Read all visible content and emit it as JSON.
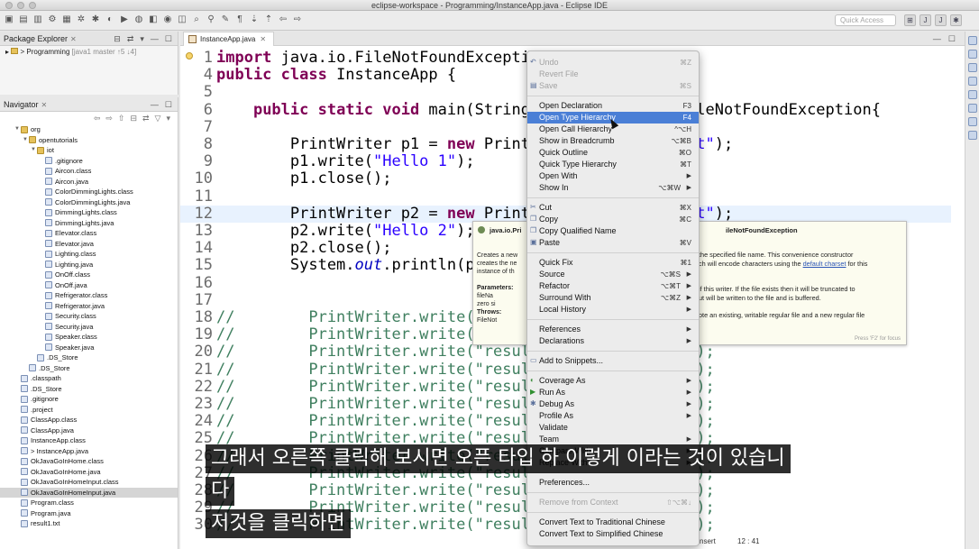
{
  "window": {
    "title": "eclipse-workspace - Programming/InstanceApp.java - Eclipse IDE",
    "quick_access_placeholder": "Quick Access"
  },
  "package_explorer": {
    "title": "Package Explorer",
    "project_label": "> Programming",
    "project_meta": "[java1 master ↑5 ↓4]"
  },
  "navigator": {
    "title": "Navigator",
    "items": [
      {
        "indent": 1,
        "twisty": "▼",
        "icon": "folder",
        "label": "org"
      },
      {
        "indent": 2,
        "twisty": "▼",
        "icon": "folder",
        "label": "opentutorials"
      },
      {
        "indent": 3,
        "twisty": "▼",
        "icon": "folder",
        "label": "iot"
      },
      {
        "indent": 4,
        "twisty": "",
        "icon": "file",
        "label": ".gitignore"
      },
      {
        "indent": 4,
        "twisty": "",
        "icon": "file",
        "label": "Aircon.class"
      },
      {
        "indent": 4,
        "twisty": "",
        "icon": "file",
        "label": "Aircon.java"
      },
      {
        "indent": 4,
        "twisty": "",
        "icon": "file",
        "label": "ColorDimmingLights.class"
      },
      {
        "indent": 4,
        "twisty": "",
        "icon": "file",
        "label": "ColorDimmingLights.java"
      },
      {
        "indent": 4,
        "twisty": "",
        "icon": "file",
        "label": "DimmingLights.class"
      },
      {
        "indent": 4,
        "twisty": "",
        "icon": "file",
        "label": "DimmingLights.java"
      },
      {
        "indent": 4,
        "twisty": "",
        "icon": "file",
        "label": "Elevator.class"
      },
      {
        "indent": 4,
        "twisty": "",
        "icon": "file",
        "label": "Elevator.java"
      },
      {
        "indent": 4,
        "twisty": "",
        "icon": "file",
        "label": "Lighting.class"
      },
      {
        "indent": 4,
        "twisty": "",
        "icon": "file",
        "label": "Lighting.java"
      },
      {
        "indent": 4,
        "twisty": "",
        "icon": "file",
        "label": "OnOff.class"
      },
      {
        "indent": 4,
        "twisty": "",
        "icon": "file",
        "label": "OnOff.java"
      },
      {
        "indent": 4,
        "twisty": "",
        "icon": "file",
        "label": "Refrigerator.class"
      },
      {
        "indent": 4,
        "twisty": "",
        "icon": "file",
        "label": "Refrigerator.java"
      },
      {
        "indent": 4,
        "twisty": "",
        "icon": "file",
        "label": "Security.class"
      },
      {
        "indent": 4,
        "twisty": "",
        "icon": "file",
        "label": "Security.java"
      },
      {
        "indent": 4,
        "twisty": "",
        "icon": "file",
        "label": "Speaker.class"
      },
      {
        "indent": 4,
        "twisty": "",
        "icon": "file",
        "label": "Speaker.java"
      },
      {
        "indent": 3,
        "twisty": "",
        "icon": "file",
        "label": ".DS_Store"
      },
      {
        "indent": 2,
        "twisty": "",
        "icon": "file",
        "label": ".DS_Store"
      },
      {
        "indent": 1,
        "twisty": "",
        "icon": "file",
        "label": ".classpath"
      },
      {
        "indent": 1,
        "twisty": "",
        "icon": "file",
        "label": ".DS_Store"
      },
      {
        "indent": 1,
        "twisty": "",
        "icon": "file",
        "label": ".gitignore"
      },
      {
        "indent": 1,
        "twisty": "",
        "icon": "file",
        "label": ".project"
      },
      {
        "indent": 1,
        "twisty": "",
        "icon": "file",
        "label": "ClassApp.class"
      },
      {
        "indent": 1,
        "twisty": "",
        "icon": "file",
        "label": "ClassApp.java"
      },
      {
        "indent": 1,
        "twisty": "",
        "icon": "file",
        "label": "InstanceApp.class"
      },
      {
        "indent": 1,
        "twisty": "",
        "icon": "file",
        "label": "> InstanceApp.java"
      },
      {
        "indent": 1,
        "twisty": "",
        "icon": "file",
        "label": "OkJavaGoInHome.class"
      },
      {
        "indent": 1,
        "twisty": "",
        "icon": "file",
        "label": "OkJavaGoInHome.java"
      },
      {
        "indent": 1,
        "twisty": "",
        "icon": "file",
        "label": "OkJavaGoInHomeInput.class"
      },
      {
        "indent": 1,
        "twisty": "",
        "icon": "file",
        "label": "OkJavaGoInHomeInput.java",
        "selected": true
      },
      {
        "indent": 1,
        "twisty": "",
        "icon": "file",
        "label": "Program.class"
      },
      {
        "indent": 1,
        "twisty": "",
        "icon": "file",
        "label": "Program.java"
      },
      {
        "indent": 1,
        "twisty": "",
        "icon": "file",
        "label": "result1.txt"
      }
    ]
  },
  "editor": {
    "tab_label": "InstanceApp.java",
    "lines": [
      {
        "n": "1",
        "html": "<span class=\"kw\">import</span> java.io.FileNotFoundException;"
      },
      {
        "n": "4",
        "html": "<span class=\"kw\">public class</span> InstanceApp {"
      },
      {
        "n": "5",
        "html": ""
      },
      {
        "n": "6",
        "html": "    <span class=\"kw\">public static void</span> main(String[] args) <span class=\"kw\">throws</span> FileNotFoundException{"
      },
      {
        "n": "7",
        "html": ""
      },
      {
        "n": "8",
        "html": "        PrintWriter p1 = <span class=\"kw\">new</span> PrintWriter(<span class=\"str\">\"result1.txt\"</span>);"
      },
      {
        "n": "9",
        "html": "        p1.write(<span class=\"str\">\"Hello 1\"</span>);"
      },
      {
        "n": "10",
        "html": "        p1.close();"
      },
      {
        "n": "11",
        "html": ""
      },
      {
        "n": "12",
        "html": "        PrintWriter p2 = <span class=\"kw\">new</span> PrintWriter(<span class=\"str\">\"result2.txt\"</span>);",
        "hl": true
      },
      {
        "n": "13",
        "html": "        p2.write(<span class=\"str\">\"Hello 2\"</span>);"
      },
      {
        "n": "14",
        "html": "        p2.close();"
      },
      {
        "n": "15",
        "html": "        System.<span class=\"fld\">out</span>.println(p1);"
      },
      {
        "n": "16",
        "html": ""
      },
      {
        "n": "17",
        "html": ""
      },
      {
        "n": "18",
        "html": "<span class=\"cmt\">//        PrintWriter.write(\"result1.txt\", \"Hello 1\");</span>"
      },
      {
        "n": "19",
        "html": "<span class=\"cmt\">//        PrintWriter.write(\"result1.txt\", \"Hello 1\");</span>"
      },
      {
        "n": "20",
        "html": "<span class=\"cmt\">//        PrintWriter.write(\"result1.txt\", \"Hello 1\");</span>"
      },
      {
        "n": "21",
        "html": "<span class=\"cmt\">//        PrintWriter.write(\"result2.txt\", \"Hello 2\");</span>"
      },
      {
        "n": "22",
        "html": "<span class=\"cmt\">//        PrintWriter.write(\"result1.txt\", \"Hello 1\");</span>"
      },
      {
        "n": "23",
        "html": "<span class=\"cmt\">//        PrintWriter.write(\"result2.txt\", \"Hello 2\");</span>"
      },
      {
        "n": "24",
        "html": "<span class=\"cmt\">//        PrintWriter.write(\"result1.txt\", \"Hello 1\");</span>"
      },
      {
        "n": "25",
        "html": "<span class=\"cmt\">//        PrintWriter.write(\"result2.txt\", \"Hello 2\");</span>"
      },
      {
        "n": "26",
        "html": "<span class=\"cmt\">//        PrintWriter.write(\"result1.txt\", \"Hello 1\");</span>"
      },
      {
        "n": "27",
        "html": "<span class=\"cmt\">//        PrintWriter.write(\"result2.txt\", \"Hello 2\");</span>"
      },
      {
        "n": "28",
        "html": "<span class=\"cmt\">//        PrintWriter.write(\"result1.txt\", \"Hello 1\");</span>"
      },
      {
        "n": "29",
        "html": "<span class=\"cmt\">//        PrintWriter.write(\"result2.txt\", \"Hello 2\");</span>"
      },
      {
        "n": "30",
        "html": "<span class=\"cmt\">//        PrintWriter.write(\"result1.txt\", \"Hello 1\");</span>"
      }
    ]
  },
  "hover_doc": {
    "title_left": "java.io.Pri",
    "title_right": "ileNotFoundException",
    "left_lines": [
      "Creates a new",
      "creates the ne",
      "instance of th",
      "",
      "Parameters:",
      "   fileNa",
      "   zero si",
      "Throws:",
      "   FileNot"
    ],
    "right_lines": [
      "the specified file name. This convenience constructor",
      "ch will encode characters using the ",
      "",
      "",
      "if this writer. If the file exists then it will be truncated to",
      "ut will be written to the file and is buffered.",
      "",
      "ote an existing, writable regular file and a new regular file"
    ],
    "link": "default charset",
    "link_tail": " for this",
    "footer": "Press 'F2' for focus"
  },
  "context_menu": {
    "items": [
      {
        "type": "item",
        "label": "Undo",
        "shortcut": "⌘Z",
        "disabled": true,
        "icon": "undo-icon"
      },
      {
        "type": "item",
        "label": "Revert File",
        "shortcut": "",
        "disabled": true
      },
      {
        "type": "item",
        "label": "Save",
        "shortcut": "⌘S",
        "disabled": true,
        "icon": "save-icon"
      },
      {
        "type": "sep"
      },
      {
        "type": "item",
        "label": "Open Declaration",
        "shortcut": "F3"
      },
      {
        "type": "item",
        "label": "Open Type Hierarchy",
        "shortcut": "F4",
        "active": true
      },
      {
        "type": "item",
        "label": "Open Call Hierarchy",
        "shortcut": "^⌥H"
      },
      {
        "type": "item",
        "label": "Show in Breadcrumb",
        "shortcut": "⌥⌘B"
      },
      {
        "type": "item",
        "label": "Quick Outline",
        "shortcut": "⌘O"
      },
      {
        "type": "item",
        "label": "Quick Type Hierarchy",
        "shortcut": "⌘T"
      },
      {
        "type": "item",
        "label": "Open With",
        "shortcut": "",
        "submenu": true
      },
      {
        "type": "item",
        "label": "Show In",
        "shortcut": "⌥⌘W",
        "submenu": true
      },
      {
        "type": "sep"
      },
      {
        "type": "item",
        "label": "Cut",
        "shortcut": "⌘X",
        "icon": "cut-icon"
      },
      {
        "type": "item",
        "label": "Copy",
        "shortcut": "⌘C",
        "icon": "copy-icon"
      },
      {
        "type": "item",
        "label": "Copy Qualified Name",
        "shortcut": "",
        "icon": "copy-qualified-icon"
      },
      {
        "type": "item",
        "label": "Paste",
        "shortcut": "⌘V",
        "icon": "paste-icon"
      },
      {
        "type": "sep"
      },
      {
        "type": "item",
        "label": "Quick Fix",
        "shortcut": "⌘1"
      },
      {
        "type": "item",
        "label": "Source",
        "shortcut": "⌥⌘S",
        "submenu": true
      },
      {
        "type": "item",
        "label": "Refactor",
        "shortcut": "⌥⌘T",
        "submenu": true
      },
      {
        "type": "item",
        "label": "Surround With",
        "shortcut": "⌥⌘Z",
        "submenu": true
      },
      {
        "type": "item",
        "label": "Local History",
        "shortcut": "",
        "submenu": true
      },
      {
        "type": "sep"
      },
      {
        "type": "item",
        "label": "References",
        "shortcut": "",
        "submenu": true
      },
      {
        "type": "item",
        "label": "Declarations",
        "shortcut": "",
        "submenu": true
      },
      {
        "type": "sep"
      },
      {
        "type": "item",
        "label": "Add to Snippets...",
        "shortcut": "",
        "icon": "snippet-icon"
      },
      {
        "type": "sep"
      },
      {
        "type": "item",
        "label": "Coverage As",
        "shortcut": "",
        "submenu": true,
        "icon": "coverage-icon"
      },
      {
        "type": "item",
        "label": "Run As",
        "shortcut": "",
        "submenu": true,
        "icon": "run-icon"
      },
      {
        "type": "item",
        "label": "Debug As",
        "shortcut": "",
        "submenu": true,
        "icon": "debug-icon"
      },
      {
        "type": "item",
        "label": "Profile As",
        "shortcut": "",
        "submenu": true
      },
      {
        "type": "item",
        "label": "Validate",
        "shortcut": ""
      },
      {
        "type": "item",
        "label": "Team",
        "shortcut": "",
        "submenu": true
      },
      {
        "type": "item",
        "label": "Compare With",
        "shortcut": "",
        "submenu": true
      },
      {
        "type": "item",
        "label": "Replace With",
        "shortcut": "",
        "submenu": true
      },
      {
        "type": "sep"
      },
      {
        "type": "item",
        "label": "Preferences...",
        "shortcut": ""
      },
      {
        "type": "sep"
      },
      {
        "type": "item",
        "label": "Remove from Context",
        "shortcut": "⇧⌥⌘↓",
        "disabled": true
      },
      {
        "type": "sep"
      },
      {
        "type": "item",
        "label": "Convert Text to Traditional Chinese",
        "shortcut": ""
      },
      {
        "type": "item",
        "label": "Convert Text to Simplified Chinese",
        "shortcut": ""
      }
    ]
  },
  "status": {
    "insert_mode": "nsert",
    "position": "12 : 41"
  },
  "subtitles": {
    "line1": "그래서 오른쪽 클릭해 보시면 오픈 타입 하 이렇게 이라는 것이 있습니",
    "line2": "다",
    "line3": "저것을 클릭하면"
  }
}
